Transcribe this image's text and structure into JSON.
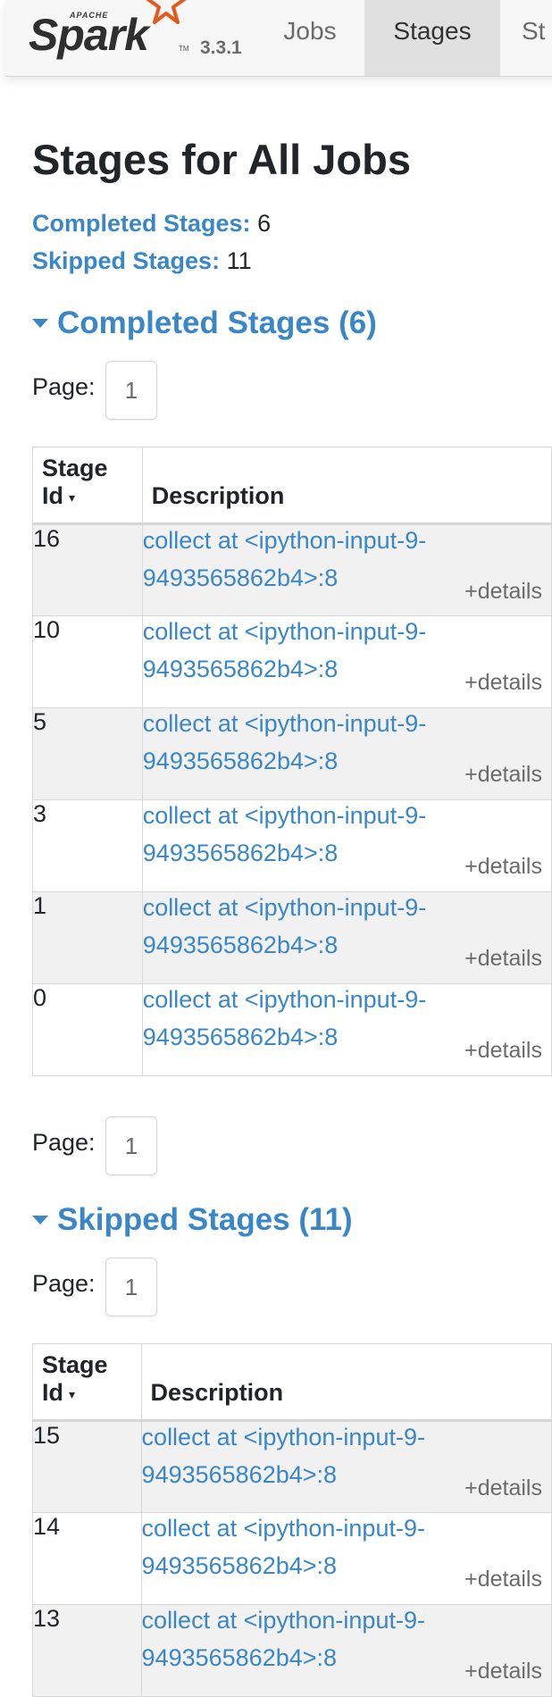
{
  "navbar": {
    "brand_apache": "APACHE",
    "brand_name": "Spark",
    "brand_tm": "TM",
    "version": "3.3.1",
    "tabs": [
      {
        "label": "Jobs",
        "active": false
      },
      {
        "label": "Stages",
        "active": true
      },
      {
        "label": "St",
        "active": false
      }
    ]
  },
  "page": {
    "title": "Stages for All Jobs",
    "summary": {
      "completed_label": "Completed Stages:",
      "completed_value": "6",
      "skipped_label": "Skipped Stages:",
      "skipped_value": "11"
    }
  },
  "completed": {
    "heading": "Completed Stages (6)",
    "pager_label": "Page:",
    "page_top": "1",
    "page_bottom": "1",
    "columns": {
      "id": "Stage Id",
      "sort_indicator": "▾",
      "description": "Description"
    },
    "rows": [
      {
        "id": "16",
        "description": "collect at <ipython-input-9-9493565862b4>:8",
        "details": "+details"
      },
      {
        "id": "10",
        "description": "collect at <ipython-input-9-9493565862b4>:8",
        "details": "+details"
      },
      {
        "id": "5",
        "description": "collect at <ipython-input-9-9493565862b4>:8",
        "details": "+details"
      },
      {
        "id": "3",
        "description": "collect at <ipython-input-9-9493565862b4>:8",
        "details": "+details"
      },
      {
        "id": "1",
        "description": "collect at <ipython-input-9-9493565862b4>:8",
        "details": "+details"
      },
      {
        "id": "0",
        "description": "collect at <ipython-input-9-9493565862b4>:8",
        "details": "+details"
      }
    ]
  },
  "skipped": {
    "heading": "Skipped Stages (11)",
    "pager_label": "Page:",
    "page_top": "1",
    "columns": {
      "id": "Stage Id",
      "sort_indicator": "▾",
      "description": "Description"
    },
    "rows": [
      {
        "id": "15",
        "description": "collect at <ipython-input-9-9493565862b4>:8",
        "details": "+details"
      },
      {
        "id": "14",
        "description": "collect at <ipython-input-9-9493565862b4>:8",
        "details": "+details"
      },
      {
        "id": "13",
        "description": "collect at <ipython-input-9-9493565862b4>:8",
        "details": "+details"
      }
    ]
  },
  "colors": {
    "link": "#3a87c8",
    "text": "#212529",
    "muted": "#6b6b6b",
    "stripe": "#f1f1f1",
    "navbar": "#f7f7f7"
  }
}
